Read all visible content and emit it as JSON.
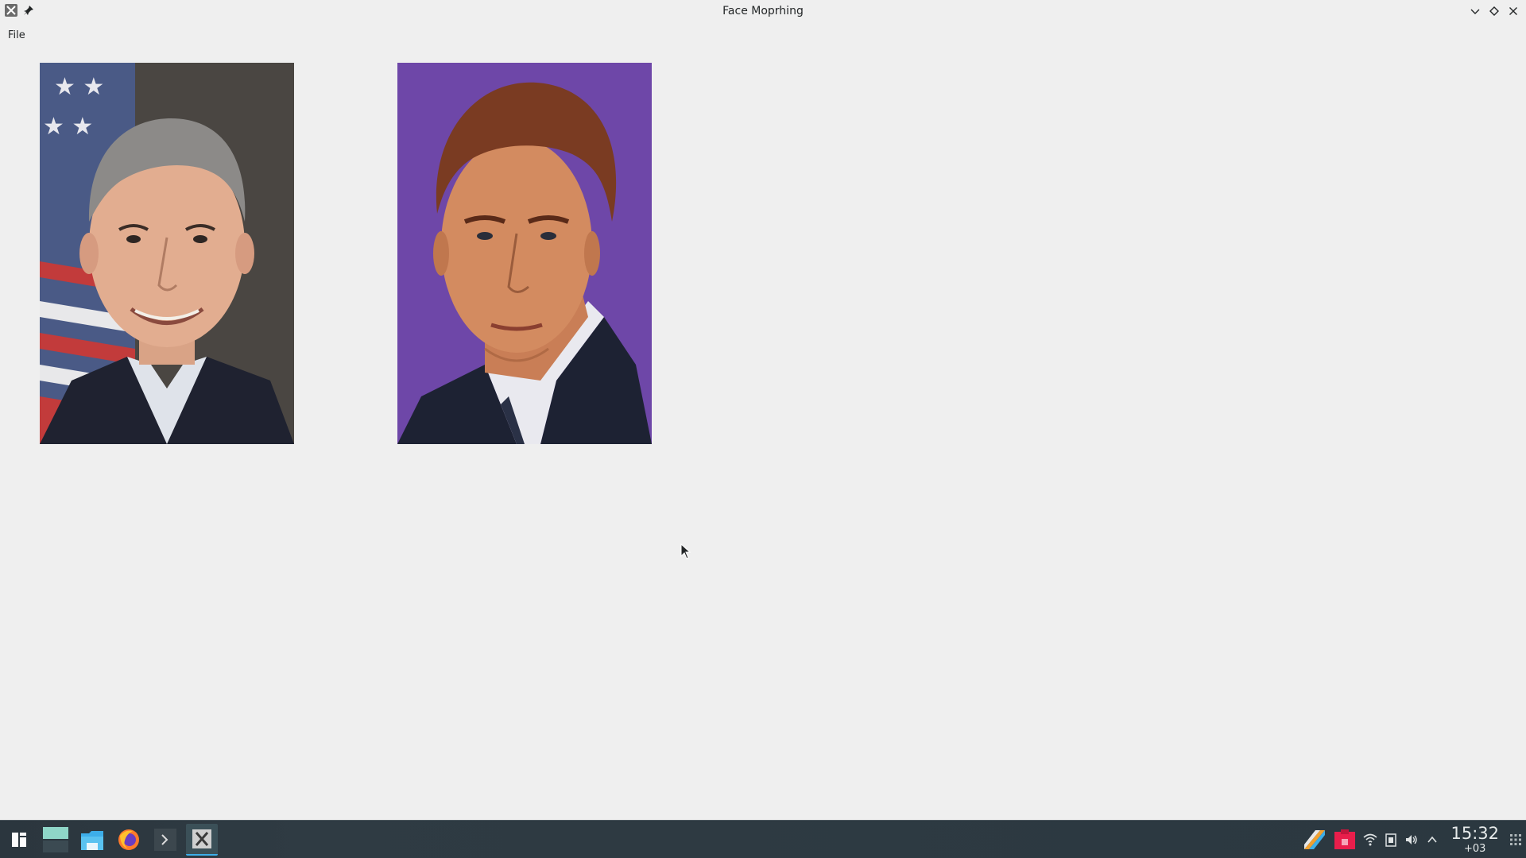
{
  "window": {
    "title": "Face Moprhing"
  },
  "menubar": {
    "items": [
      {
        "label": "File"
      }
    ]
  },
  "images": {
    "left_alt": "Portrait 1",
    "right_alt": "Portrait 2"
  },
  "taskbar": {
    "clock_time": "15:32",
    "clock_tz": "+03"
  },
  "colors": {
    "accent": "#3daee9",
    "taskbar_bg": "#2b363e",
    "window_bg": "#efefef"
  }
}
